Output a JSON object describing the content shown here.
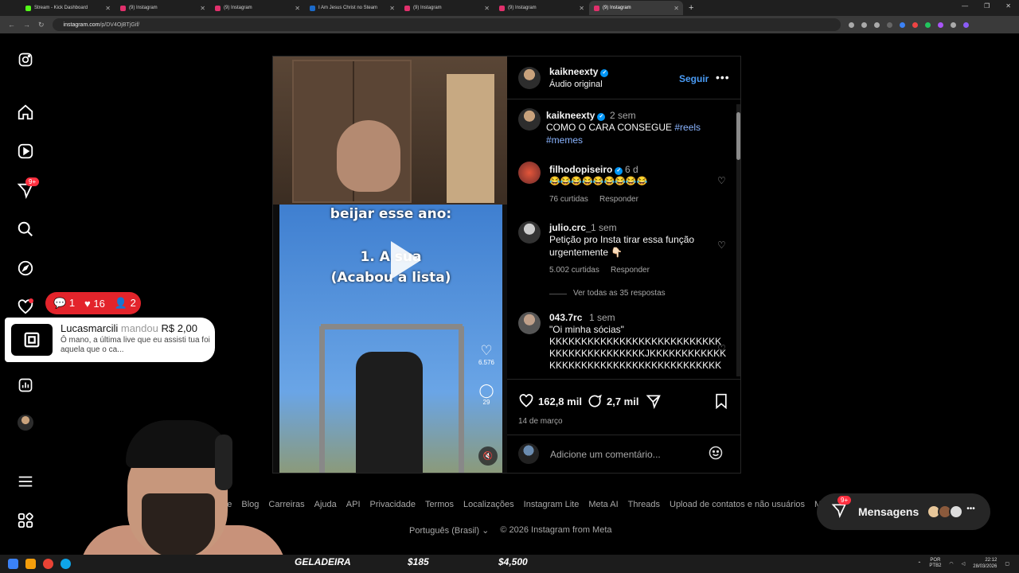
{
  "browser": {
    "tabs": [
      {
        "title": "Stream - Kick Dashboard",
        "color": "#53fc18"
      },
      {
        "title": "(9) Instagram",
        "color": "#e1306c"
      },
      {
        "title": "(9) Instagram",
        "color": "#e1306c"
      },
      {
        "title": "I Am Jesus Christ no Steam",
        "color": "#1b6ac9"
      },
      {
        "title": "(9) Instagram",
        "color": "#e1306c"
      },
      {
        "title": "(9) Instagram",
        "color": "#e1306c"
      },
      {
        "title": "(9) Instagram",
        "color": "#e1306c"
      }
    ],
    "url_host": "instagram.com",
    "url_path": "/p/DV4OjBTjGif/"
  },
  "sidebar": {
    "notif_badge": "9+"
  },
  "post": {
    "author": "kaikneexty",
    "audio": "Áudio original",
    "follow_label": "Seguir",
    "caption": {
      "author": "kaikneexty",
      "time": "2 sem",
      "text": "COMO O CARA CONSEGUE",
      "tag1": "#reels",
      "tag2": "#memes"
    },
    "comments": [
      {
        "user": "filhodopiseiro",
        "time": "6 d",
        "text": "😂😂😂😂😂😂😂😂😂",
        "likes": "76 curtidas",
        "reply": "Responder"
      },
      {
        "user": "julio.crc_",
        "time": "1 sem",
        "text": "Petição pro Insta tirar essa função urgentemente 👇🏻",
        "likes": "5.002 curtidas",
        "reply": "Responder",
        "view_replies": "Ver todas as 35 respostas"
      },
      {
        "user": "043.7rc",
        "time": "1 sem",
        "text1": "\"Oi minha sócias\"",
        "text2": "KKKKKKKKKKKKKKKKKKKKKKKKKKK",
        "text3": "KKKKKKKKKKKKKKKJKKKKKKKKKKKK",
        "text4": "KKKKKKKKKKKKKKKKKKKKKKKKKKK"
      }
    ],
    "likes": "162,8 mil",
    "comment_count": "2,7 mil",
    "date": "14 de março",
    "add_comment_placeholder": "Adicione um comentário...",
    "video": {
      "text_top": "beijar esse ano:",
      "text_line1": "1. A sua",
      "text_line2": "(Acabou a lista)",
      "like_count": "6.576",
      "comment_count": "29"
    }
  },
  "footer": {
    "links": [
      "Sobre",
      "Blog",
      "Carreiras",
      "Ajuda",
      "API",
      "Privacidade",
      "Termos",
      "Localizações",
      "Instagram Lite",
      "Meta AI",
      "Threads",
      "Upload de contatos e não usuários",
      "Meta Verified"
    ],
    "language": "Português (Brasil)",
    "copyright": "© 2026 Instagram from Meta"
  },
  "messages": {
    "label": "Mensagens",
    "badge": "9+"
  },
  "stream_overlay": {
    "chat_count": "1",
    "hearts": "16",
    "viewers": "2",
    "donation_name": "Lucasmarcili",
    "donation_verb": "mandou",
    "donation_amount": "R$ 2,00",
    "donation_message": "Ô mano, a última live que eu assisti tua foi aquela que o ca..."
  },
  "ticker": {
    "item": "GELADEIRA",
    "price1": "$185",
    "price2": "$4,500"
  },
  "tray": {
    "lang": "POR",
    "layout": "PTB2",
    "time": "22:12",
    "date": "28/03/2026"
  }
}
